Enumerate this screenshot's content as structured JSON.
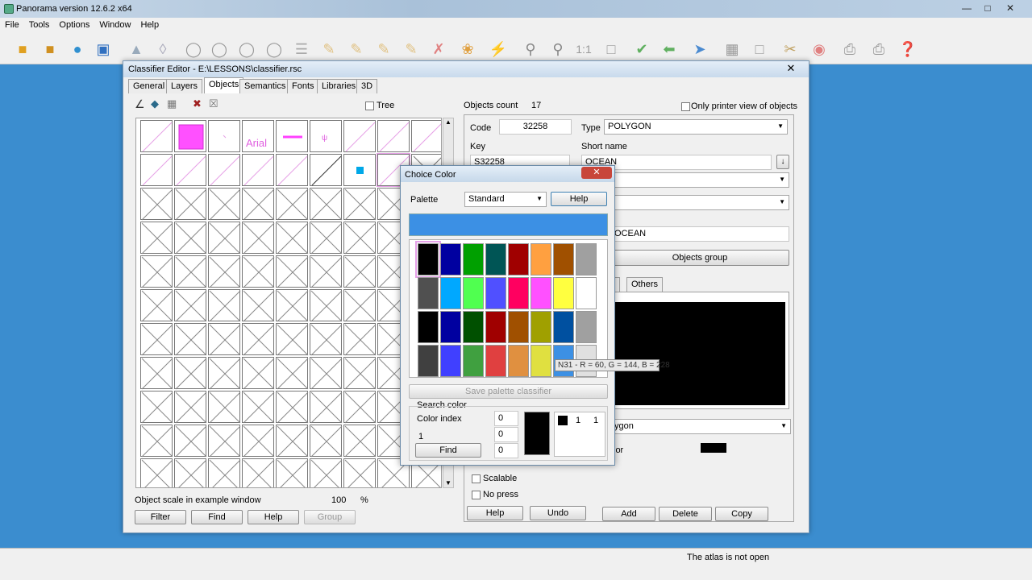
{
  "app": {
    "title": "Panorama version 12.6.2 x64",
    "menu": [
      "File",
      "Tools",
      "Options",
      "Window",
      "Help"
    ],
    "status": "The atlas is not open"
  },
  "editor": {
    "title": "Classifier Editor - E:\\LESSONS\\classifier.rsc",
    "tabs": [
      "General",
      "Layers",
      "Objects",
      "Semantics",
      "Fonts",
      "Libraries",
      "3D"
    ],
    "active_tab": "Objects",
    "tree_label": "Tree",
    "sample_text": "Arial",
    "scale_label": "Object scale in example window",
    "scale_value": "100",
    "scale_unit": "%",
    "left_buttons": {
      "filter": "Filter",
      "find": "Find",
      "help": "Help",
      "group": "Group"
    },
    "objects_count_label": "Objects count",
    "objects_count": "17",
    "printer_view_label": "Only printer view of objects",
    "code_label": "Code",
    "code_value": "32258",
    "type_label": "Type",
    "type_value": "POLYGON",
    "key_label": "Key",
    "key_value": "S32258",
    "short_name_label": "Short name",
    "short_name_value": "OCEAN",
    "name_value": "OCEAN",
    "objects_group_label": "Objects group",
    "others_tab": "Others",
    "polygon_value": "ygon",
    "color_label_fragment": "lor",
    "scalable_label": "Scalable",
    "no_press_label": "No press",
    "bottom_buttons": {
      "help": "Help",
      "undo": "Undo",
      "add": "Add",
      "delete": "Delete",
      "copy": "Copy"
    }
  },
  "choice_color": {
    "title": "Choice Color",
    "palette_label": "Palette",
    "palette_value": "Standard",
    "help_label": "Help",
    "preview_color": "#3c90e4",
    "swatches": [
      [
        "#000000",
        "#0000a0",
        "#00a000",
        "#005555",
        "#a00000",
        "#ffa040",
        "#a05000",
        "#a0a0a0"
      ],
      [
        "#505050",
        "#00a8ff",
        "#50ff50",
        "#5050ff",
        "#ff0060",
        "#ff50ff",
        "#ffff40",
        "#ffffff"
      ],
      [
        "#000000",
        "#0000a0",
        "#005000",
        "#a00000",
        "#a05000",
        "#a0a000",
        "#0050a0",
        "#a0a0a0"
      ],
      [
        "#404040",
        "#4040ff",
        "#40a040",
        "#e04040",
        "#e09040",
        "#e0e040",
        "#3c90e4",
        "#e0e0e0"
      ]
    ],
    "tooltip": "N31 - R = 60, G = 144, B = 228",
    "save_label": "Save palette classifier",
    "search_label": "Search color",
    "color_index_label": "Color index",
    "search_values": [
      "0",
      "0",
      "0"
    ],
    "count_label": "1",
    "find_label": "Find",
    "mini_values": [
      "1",
      "1"
    ]
  }
}
